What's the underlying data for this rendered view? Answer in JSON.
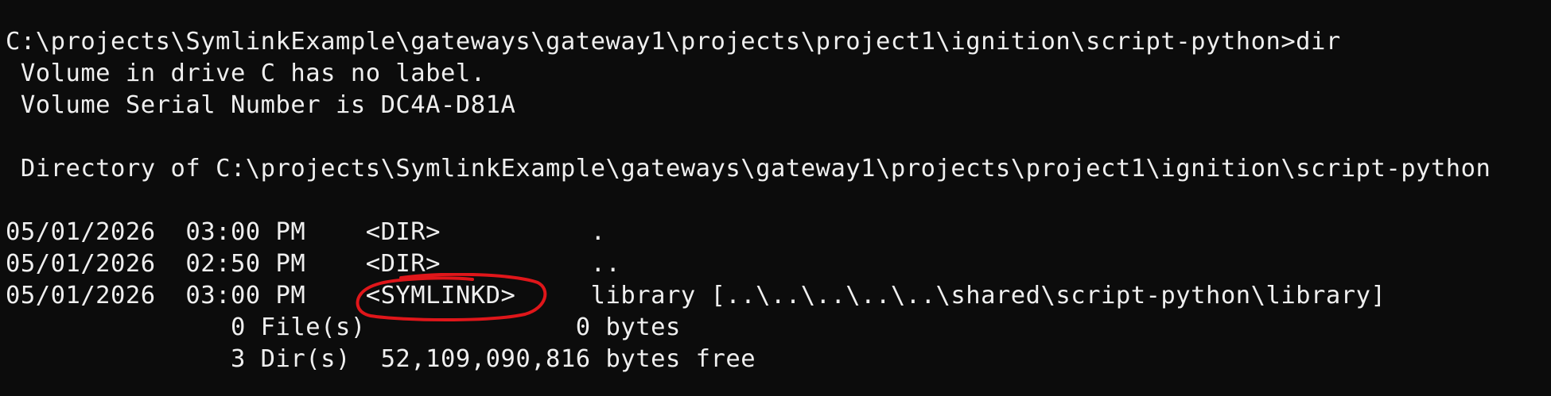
{
  "terminal": {
    "lines": [
      "C:\\projects\\SymlinkExample\\gateways\\gateway1\\projects\\project1\\ignition\\script-python>dir",
      " Volume in drive C has no label.",
      " Volume Serial Number is DC4A-D81A",
      "",
      " Directory of C:\\projects\\SymlinkExample\\gateways\\gateway1\\projects\\project1\\ignition\\script-python",
      "",
      "05/01/2026  03:00 PM    <DIR>          .",
      "05/01/2026  02:50 PM    <DIR>          ..",
      "05/01/2026  03:00 PM    <SYMLINKD>     library [..\\..\\..\\..\\..\\shared\\script-python\\library]",
      "               0 File(s)              0 bytes",
      "               3 Dir(s)  52,109,090,816 bytes free"
    ]
  },
  "annotation": {
    "stroke_color": "#e0161a"
  }
}
